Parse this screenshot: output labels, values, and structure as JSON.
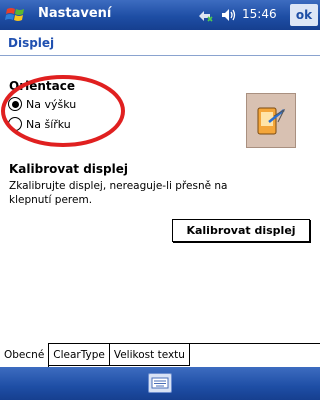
{
  "titlebar": {
    "app_title": "Nastavení",
    "clock": "15:46",
    "ok_label": "ok",
    "icons": [
      "windows-start-icon",
      "connectivity-icon",
      "speaker-icon"
    ]
  },
  "page": {
    "title": "Displej"
  },
  "orientation": {
    "label": "Orientace",
    "options": [
      {
        "label": "Na výšku",
        "selected": true
      },
      {
        "label": "Na šířku",
        "selected": false
      }
    ],
    "highlight_color": "#e02020"
  },
  "calibration": {
    "title": "Kalibrovat displej",
    "description": "Zkalibrujte displej, nereaguje-li přesně na klepnutí perem.",
    "button_label": "Kalibrovat displej"
  },
  "tabs": [
    {
      "label": "Obecné",
      "active": true
    },
    {
      "label": "ClearType",
      "active": false
    },
    {
      "label": "Velikost textu",
      "active": false
    }
  ],
  "bottombar": {
    "icon": "keyboard-icon"
  },
  "colors": {
    "bar_blue": "#1e4ea5",
    "title_blue": "#2050b0",
    "highlight": "#e02020"
  }
}
